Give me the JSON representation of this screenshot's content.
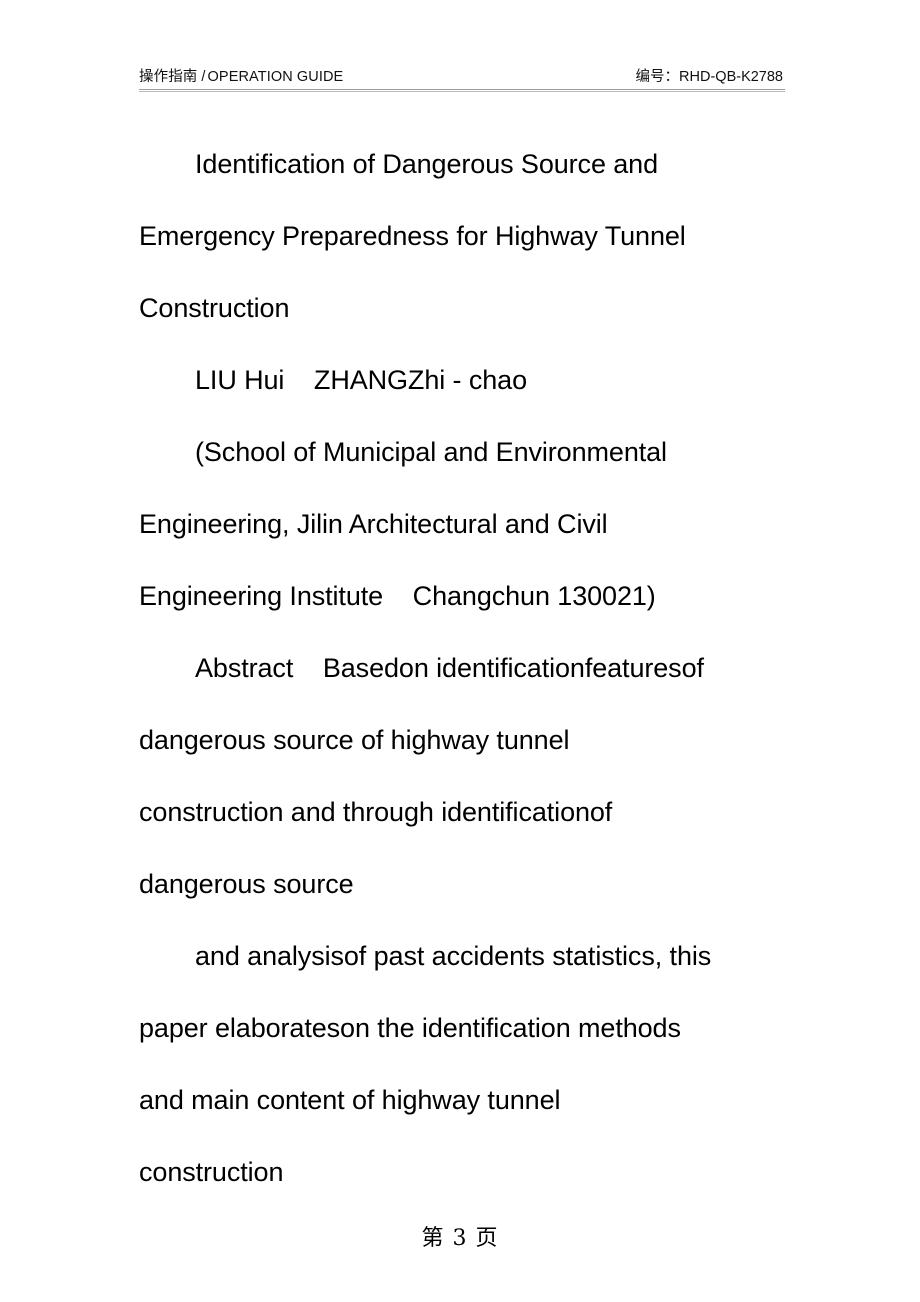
{
  "document": {
    "header": {
      "left_cjk": "操作指南",
      "separator": "/",
      "left_latin": "OPERATION GUIDE",
      "right_label": "编号：",
      "right_value": "RHD-QB-K2788"
    },
    "body_lines": [
      {
        "text": "Identification of Dangerous Source and",
        "indent": true
      },
      {
        "text": "Emergency Preparedness for Highway Tunnel",
        "indent": false
      },
      {
        "text": "Construction",
        "indent": false
      },
      {
        "text": "LIU Hui    ZHANGZhi - chao",
        "indent": true
      },
      {
        "text": "(School of Municipal and Environmental",
        "indent": true
      },
      {
        "text": "Engineering, Jilin Architectural and Civil",
        "indent": false
      },
      {
        "text": "Engineering Institute    Changchun 130021)",
        "indent": false
      },
      {
        "text": "Abstract    Basedon identificationfeaturesof",
        "indent": true
      },
      {
        "text": "dangerous source of highway tunnel",
        "indent": false
      },
      {
        "text": "construction and through identificationof",
        "indent": false
      },
      {
        "text": "dangerous source",
        "indent": false
      },
      {
        "text": "and analysisof past accidents statistics, this",
        "indent": true
      },
      {
        "text": "paper elaborateson the identification methods",
        "indent": false
      },
      {
        "text": "and main content of highway tunnel",
        "indent": false
      },
      {
        "text": "construction",
        "indent": false
      }
    ],
    "footer": {
      "text": "第 3 页",
      "page_number": "3"
    }
  }
}
